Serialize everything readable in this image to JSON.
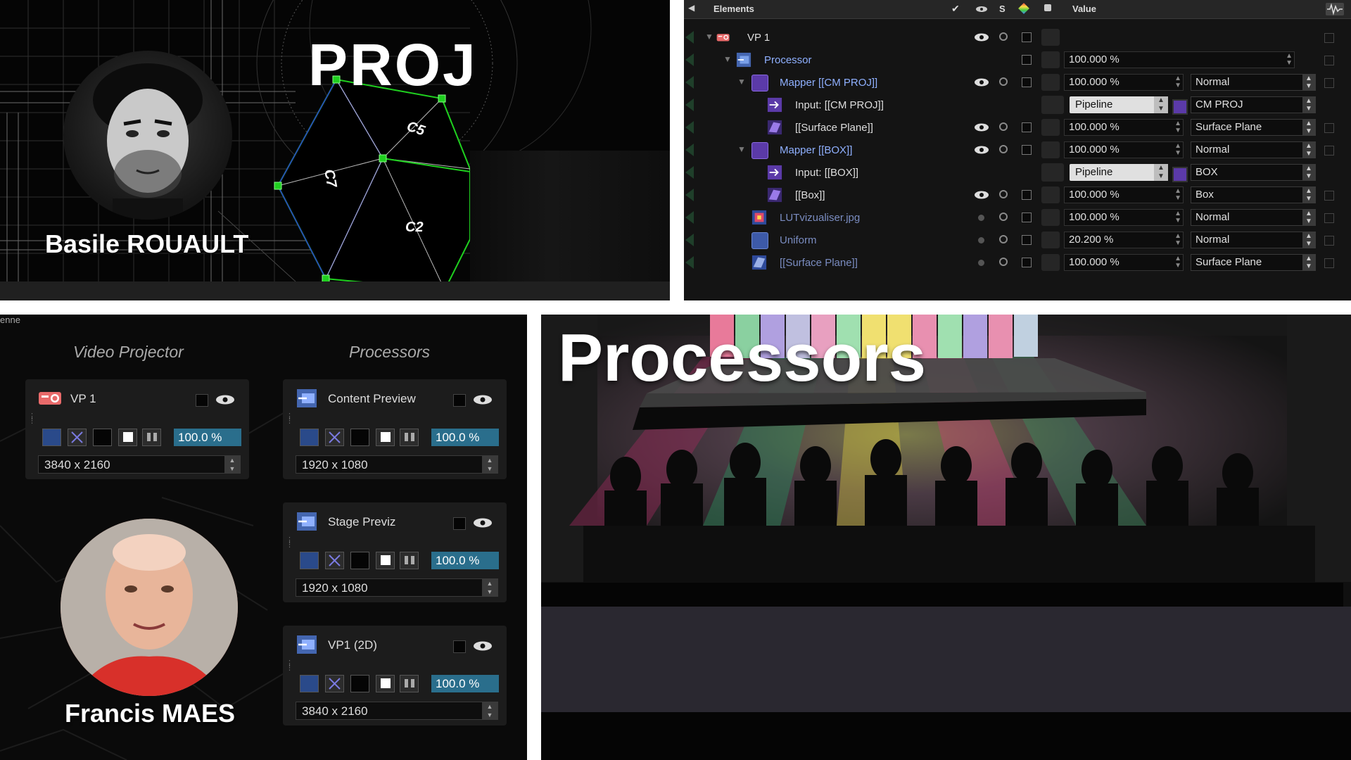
{
  "proj_panel": {
    "title": "PROJ",
    "person_name": "Basile ROUAULT",
    "camera_labels": [
      "C5",
      "C7",
      "C2"
    ]
  },
  "elements_panel": {
    "header": {
      "title": "Elements",
      "col_s": "S",
      "col_value": "Value"
    },
    "rows": [
      {
        "label": "VP 1",
        "opacity": "",
        "type": "",
        "param": ""
      },
      {
        "label": "Processor",
        "opacity": "100.000 %",
        "type": "",
        "param": ""
      },
      {
        "label": "Mapper [[CM PROJ]]",
        "opacity": "100.000 %",
        "type": "",
        "param": "Normal"
      },
      {
        "label": "Input: [[CM PROJ]]",
        "opacity": "",
        "type": "Pipeline",
        "param": "CM PROJ"
      },
      {
        "label": "[[Surface Plane]]",
        "opacity": "100.000 %",
        "type": "",
        "param": "Surface Plane"
      },
      {
        "label": "Mapper [[BOX]]",
        "opacity": "100.000 %",
        "type": "",
        "param": "Normal"
      },
      {
        "label": "Input: [[BOX]]",
        "opacity": "",
        "type": "Pipeline",
        "param": "BOX"
      },
      {
        "label": "[[Box]]",
        "opacity": "100.000 %",
        "type": "",
        "param": "Box"
      },
      {
        "label": "LUTvizualiser.jpg",
        "opacity": "100.000 %",
        "type": "",
        "param": "Normal"
      },
      {
        "label": "Uniform",
        "opacity": "20.200 %",
        "type": "",
        "param": "Normal"
      },
      {
        "label": "[[Surface Plane]]",
        "opacity": "100.000 %",
        "type": "",
        "param": "Surface Plane"
      }
    ]
  },
  "processors_ui": {
    "corner_text": "enne",
    "col_video_projector": "Video Projector",
    "col_processors": "Processors",
    "nodes": {
      "vp1": {
        "title": "VP 1",
        "percent": "100.0 %",
        "resolution": "3840 x 2160"
      },
      "content_preview": {
        "title": "Content Preview",
        "percent": "100.0 %",
        "resolution": "1920 x 1080"
      },
      "stage_previz": {
        "title": "Stage Previz",
        "percent": "100.0 %",
        "resolution": "1920 x 1080"
      },
      "vp1_2d": {
        "title": "VP1 (2D)",
        "percent": "100.0 %",
        "resolution": "3840 x 2160"
      }
    },
    "person_name": "Francis MAES"
  },
  "stage_panel": {
    "title": "Processors"
  },
  "colors": {
    "accent_purple": "#6b3fc0",
    "vp_red": "#e86a6a",
    "percent_blue": "#2a6e8c",
    "tree_blue_text": "#8fb0ff",
    "projector_green": "#1fd01f"
  }
}
